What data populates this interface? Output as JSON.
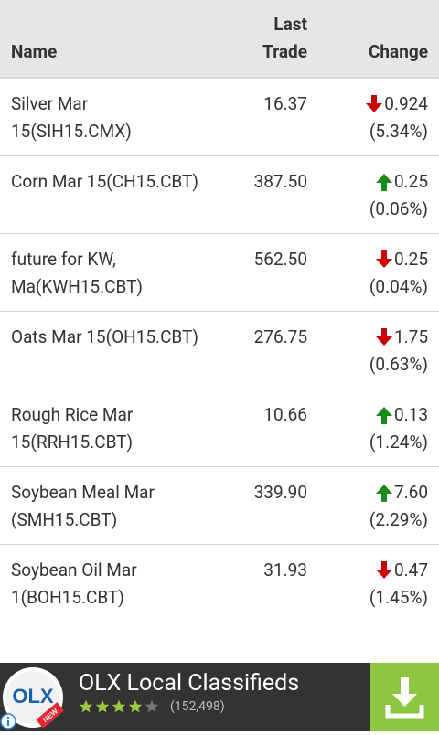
{
  "table": {
    "headers": {
      "name": "Name",
      "last_trade_line1": "Last",
      "last_trade_line2": "Trade",
      "change": "Change"
    },
    "rows": [
      {
        "name_l1": "Silver Mar",
        "name_l2": "15(SIH15.CMX)",
        "last_trade": "16.37",
        "direction": "down",
        "change": "0.924",
        "percent": "(5.34%)"
      },
      {
        "name_l1": "Corn Mar 15(CH15.CBT)",
        "name_l2": "",
        "last_trade": "387.50",
        "direction": "up",
        "change": "0.25",
        "percent": "(0.06%)"
      },
      {
        "name_l1": "future for KW,",
        "name_l2": "Ma(KWH15.CBT)",
        "last_trade": "562.50",
        "direction": "down",
        "change": "0.25",
        "percent": "(0.04%)"
      },
      {
        "name_l1": "Oats Mar 15(OH15.CBT)",
        "name_l2": "",
        "last_trade": "276.75",
        "direction": "down",
        "change": "1.75",
        "percent": "(0.63%)"
      },
      {
        "name_l1": "Rough Rice Mar",
        "name_l2": "15(RRH15.CBT)",
        "last_trade": "10.66",
        "direction": "up",
        "change": "0.13",
        "percent": "(1.24%)"
      },
      {
        "name_l1": "Soybean Meal Mar",
        "name_l2": "(SMH15.CBT)",
        "last_trade": "339.90",
        "direction": "up",
        "change": "7.60",
        "percent": "(2.29%)"
      },
      {
        "name_l1": "Soybean Oil Mar",
        "name_l2": "1(BOH15.CBT)",
        "last_trade": "31.93",
        "direction": "down",
        "change": "0.47",
        "percent": "(1.45%)"
      }
    ]
  },
  "ad": {
    "title": "OLX Local Classifieds",
    "rating_stars": 4,
    "rating_count": "(152,498)",
    "logo_text": "OLX",
    "logo_badge": "NEW",
    "download_icon": "download-icon",
    "info_icon": "info-icon"
  },
  "colors": {
    "down_arrow": "#cc0000",
    "up_arrow": "#1a8a1a",
    "header_bg": "#e6e6e6",
    "ad_bg": "#333333",
    "download_bg": "#8ec63f"
  }
}
